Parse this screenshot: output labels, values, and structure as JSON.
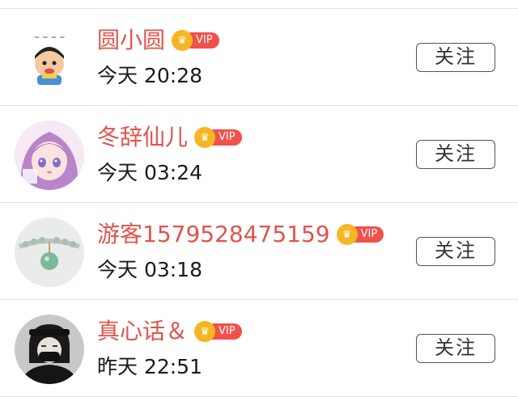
{
  "users": [
    {
      "name": "圆小圆",
      "vip_label": "VIP",
      "time": "今天 20:28",
      "follow_label": "关注",
      "avatar_icon": "cartoon-sticker-avatar"
    },
    {
      "name": "冬辞仙儿",
      "vip_label": "VIP",
      "time": "今天 03:24",
      "follow_label": "关注",
      "avatar_icon": "anime-girl-avatar"
    },
    {
      "name": "游客1579528475159",
      "vip_label": "VIP",
      "time": "今天 03:18",
      "follow_label": "关注",
      "avatar_icon": "bracelet-photo-avatar"
    },
    {
      "name": "真心话＆",
      "vip_label": "VIP",
      "time": "昨天 22:51",
      "follow_label": "关注",
      "avatar_icon": "masked-person-avatar"
    }
  ],
  "colors": {
    "name": "#e0544c",
    "vip_badge": "#f1514b",
    "crown": "#f5b623"
  }
}
